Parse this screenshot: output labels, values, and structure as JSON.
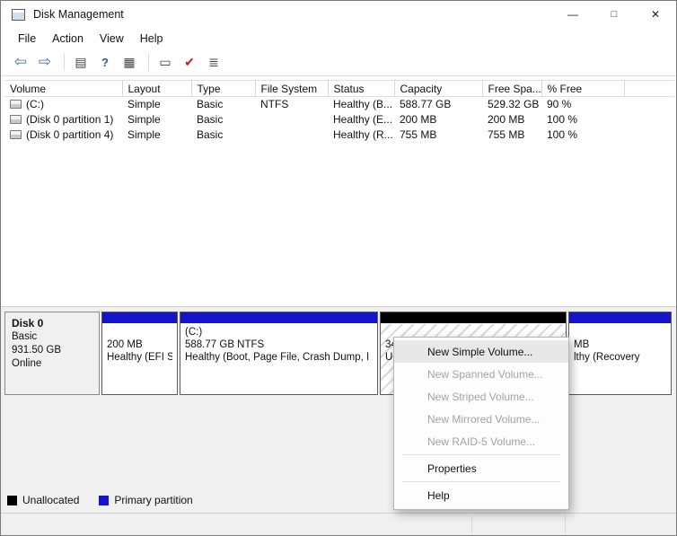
{
  "window": {
    "title": "Disk Management",
    "minimize": "—",
    "maximize": "□",
    "close": "✕"
  },
  "menubar": {
    "items": [
      "File",
      "Action",
      "View",
      "Help"
    ]
  },
  "toolbar": {
    "icons": [
      {
        "name": "back-icon",
        "glyph": "⇦"
      },
      {
        "name": "forward-icon",
        "glyph": "⇨"
      },
      {
        "name": "console-tree-icon",
        "glyph": "▤"
      },
      {
        "name": "help-icon",
        "glyph": "?"
      },
      {
        "name": "properties-icon",
        "glyph": "▦"
      },
      {
        "name": "action-pane-icon",
        "glyph": "▭"
      },
      {
        "name": "check-icon",
        "glyph": "✔"
      },
      {
        "name": "export-list-icon",
        "glyph": "≣"
      }
    ]
  },
  "volume_table": {
    "columns": [
      "Volume",
      "Layout",
      "Type",
      "File System",
      "Status",
      "Capacity",
      "Free Spa...",
      "% Free"
    ],
    "rows": [
      {
        "volume": "(C:)",
        "layout": "Simple",
        "type": "Basic",
        "file_system": "NTFS",
        "status": "Healthy (B...",
        "capacity": "588.77 GB",
        "free_space": "529.32 GB",
        "percent_free": "90 %"
      },
      {
        "volume": "(Disk 0 partition 1)",
        "layout": "Simple",
        "type": "Basic",
        "file_system": "",
        "status": "Healthy (E...",
        "capacity": "200 MB",
        "free_space": "200 MB",
        "percent_free": "100 %"
      },
      {
        "volume": "(Disk 0 partition 4)",
        "layout": "Simple",
        "type": "Basic",
        "file_system": "",
        "status": "Healthy (R...",
        "capacity": "755 MB",
        "free_space": "755 MB",
        "percent_free": "100 %"
      }
    ]
  },
  "graph": {
    "disk": {
      "name": "Disk 0",
      "type": "Basic",
      "size": "931.50 GB",
      "status": "Online"
    },
    "partitions": [
      {
        "kind": "primary",
        "line1": "",
        "line2": "200 MB",
        "line3": "Healthy (EFI S"
      },
      {
        "kind": "primary",
        "line1": "(C:)",
        "line2": "588.77 GB NTFS",
        "line3": "Healthy (Boot, Page File, Crash Dump, I"
      },
      {
        "kind": "unallocated",
        "line1": "",
        "line2": "34",
        "line3": "U"
      },
      {
        "kind": "primary",
        "line1": "",
        "line2": "MB",
        "line3": "lthy (Recovery"
      }
    ]
  },
  "context_menu": {
    "items": [
      {
        "label": "New Simple Volume...",
        "enabled": true,
        "highlighted": true
      },
      {
        "label": "New Spanned Volume...",
        "enabled": false
      },
      {
        "label": "New Striped Volume...",
        "enabled": false
      },
      {
        "label": "New Mirrored Volume...",
        "enabled": false
      },
      {
        "label": "New RAID-5 Volume...",
        "enabled": false
      },
      {
        "label": "Properties",
        "enabled": true
      },
      {
        "label": "Help",
        "enabled": true
      }
    ]
  },
  "legend": {
    "unallocated": "Unallocated",
    "primary": "Primary partition"
  },
  "colors": {
    "primary_partition": "#1414c8",
    "unallocated": "#000000",
    "menu_highlight": "#e8e8e8",
    "toolbar_arrow": "#3f6fb5"
  }
}
